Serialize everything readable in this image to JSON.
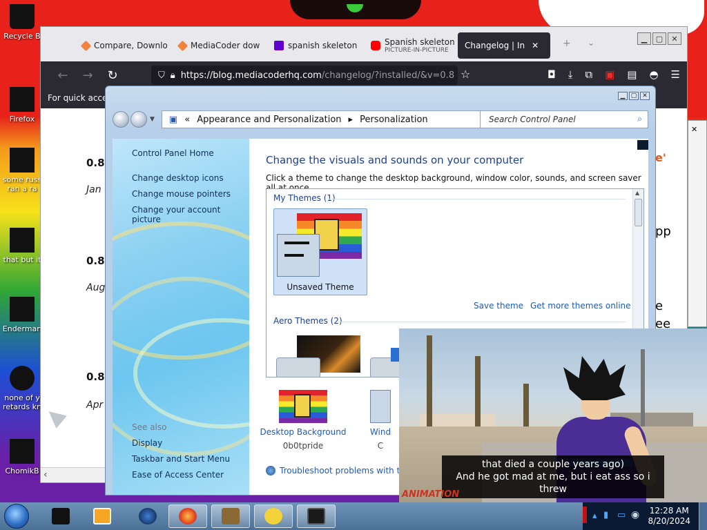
{
  "desktop": {
    "icons": [
      "Recycle B",
      "Firefox",
      "some russ ran a ra",
      "that but it",
      "Enderman",
      "none of y retards kn",
      "ChomikB"
    ]
  },
  "firefox": {
    "tabs": [
      {
        "label": "Compare, Downlo",
        "icon_color": "#f4823a"
      },
      {
        "label": "MediaCoder dow",
        "icon_color": "#f4823a"
      },
      {
        "label": "spanish skeleton",
        "icon_color": "#6001d2"
      },
      {
        "label": "Spanish skeleton",
        "sublabel": "PICTURE-IN-PICTURE",
        "icon_color": "#ff0000"
      },
      {
        "label": "Changelog | In",
        "icon_color": "#ffffff",
        "active": true
      }
    ],
    "url_host": "https://blog.mediacoderhq.com",
    "url_rest": "/changelog/?installed/&v=0.8",
    "bookmark_notice": "For quick acce",
    "page": {
      "versions": [
        {
          "version": "0.8.",
          "date": "Jan"
        },
        {
          "version": "0.8.",
          "date": "Aug"
        },
        {
          "version": "0.8.",
          "date": "Apr"
        }
      ],
      "right_fragments": [
        "e'",
        "pp",
        "e",
        "ee"
      ]
    }
  },
  "control_panel": {
    "breadcrumb": [
      "Appearance and Personalization",
      "Personalization"
    ],
    "search_placeholder": "Search Control Panel",
    "sidebar": {
      "home": "Control Panel Home",
      "links": [
        "Change desktop icons",
        "Change mouse pointers",
        "Change your account picture"
      ],
      "see_also": "See also",
      "see_also_links": [
        "Display",
        "Taskbar and Start Menu",
        "Ease of Access Center"
      ]
    },
    "heading": "Change the visuals and sounds on your computer",
    "description": "Click a theme to change the desktop background, window color, sounds, and screen saver all at once.",
    "my_themes_label": "My Themes (1)",
    "unsaved_theme": "Unsaved Theme",
    "save_theme": "Save theme",
    "get_more": "Get more themes online",
    "aero_label": "Aero Themes (2)",
    "desktop_background": {
      "name": "Desktop Background",
      "value": "0b0tpride"
    },
    "window_color": {
      "name": "Wind",
      "value": "C"
    },
    "troubleshoot": "Troubleshoot problems with tran"
  },
  "pip": {
    "caption_line1": "that died a couple years ago)",
    "caption_line2": "And he got mad at me, but i eat ass so i threw",
    "watermark": "ANIMATION"
  },
  "taskbar": {
    "items": [
      "terminal",
      "media-player",
      "globe",
      "firefox",
      "box",
      "bee",
      "monitor"
    ],
    "time": "12:28 AM",
    "date": "8/20/2024"
  }
}
